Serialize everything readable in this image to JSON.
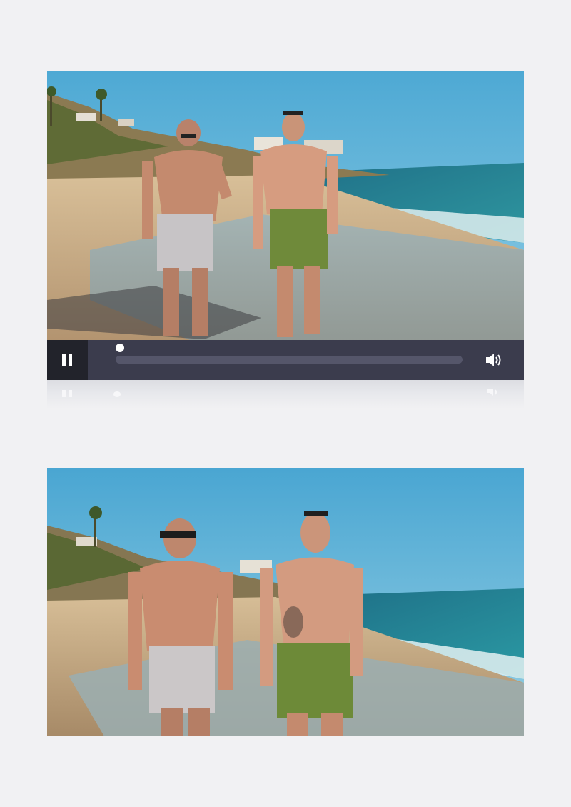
{
  "player": {
    "state": "playing",
    "progress": 0,
    "controls": {
      "play_pause_icon": "pause-icon",
      "volume_icon": "speaker-volume-icon"
    }
  },
  "scenes": [
    {
      "name": "beach-walk-wide",
      "description_icon": "video-frame"
    },
    {
      "name": "beach-walk-close",
      "description_icon": "video-frame"
    }
  ],
  "colors": {
    "page_background": "#f1f1f3",
    "control_bar": "#3b3c4d",
    "pause_button_bg": "#22232b",
    "progress_track": "#55566a",
    "knob": "#ffffff",
    "sky": "#5eb2d6",
    "sea": "#2a8a96",
    "sand": "#c9ad86"
  }
}
